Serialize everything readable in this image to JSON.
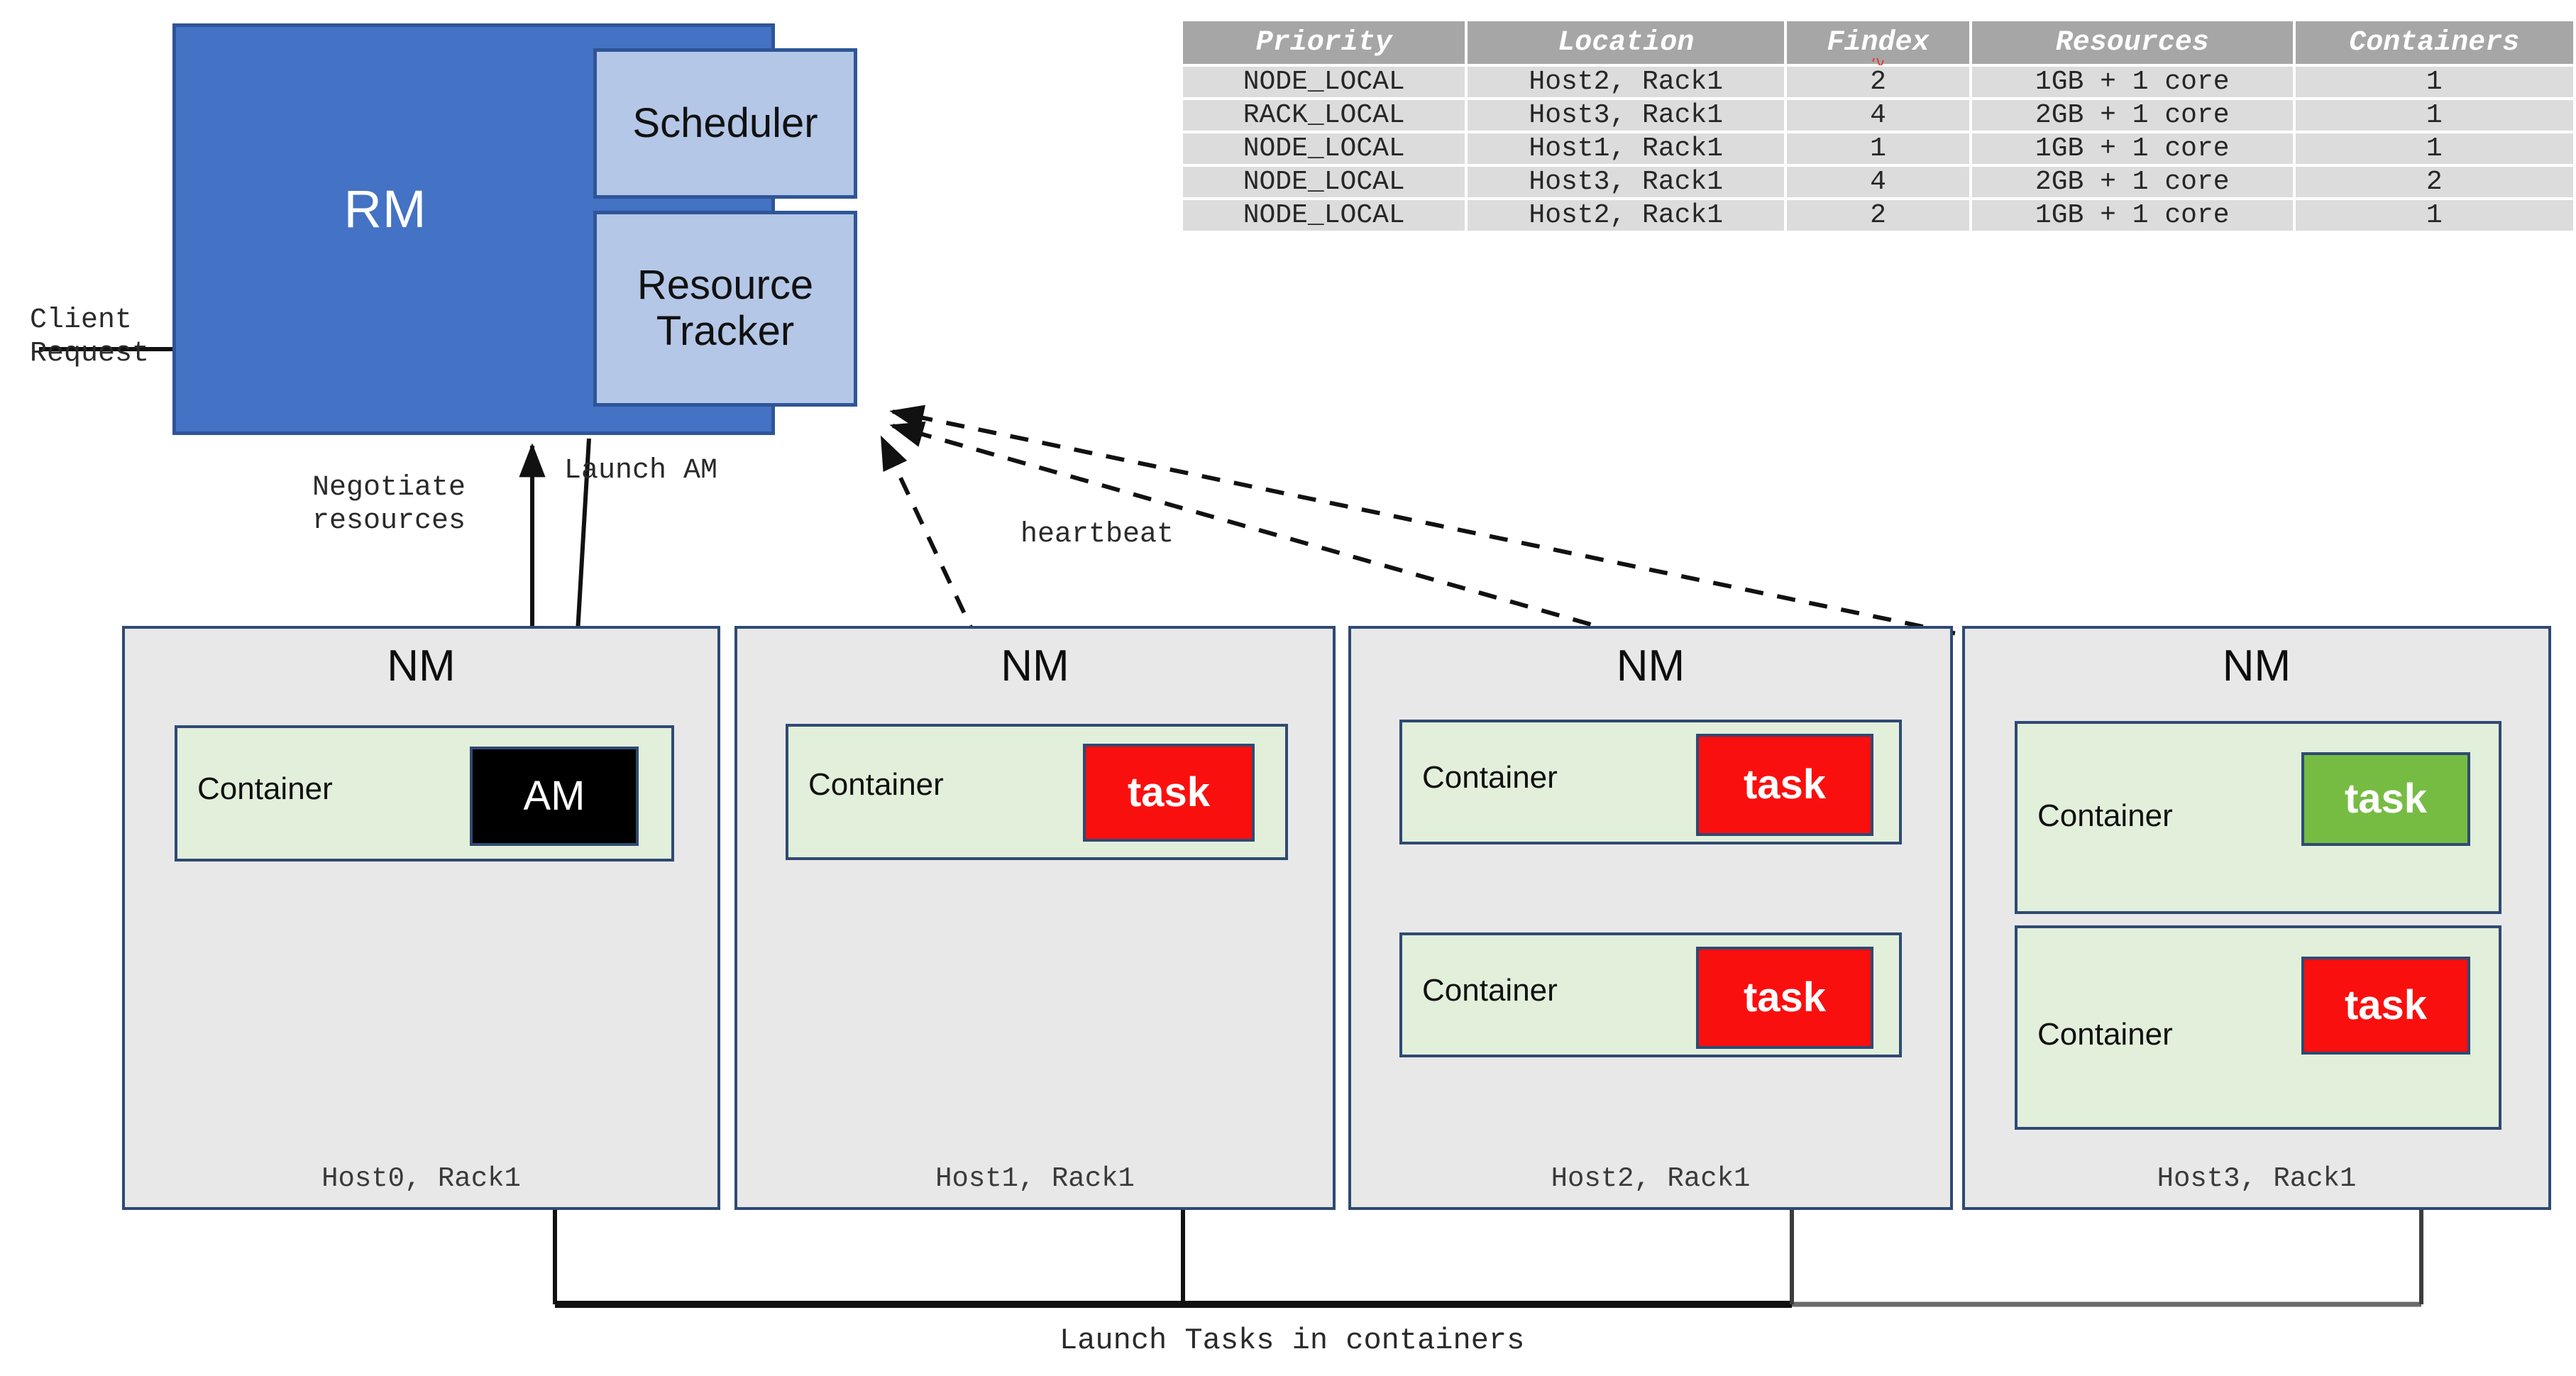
{
  "diagram": {
    "rm": {
      "label": "RM",
      "scheduler": "Scheduler",
      "resource_tracker": "Resource\nTracker",
      "fill_color": "#4472C4",
      "sub_fill_color": "#B4C7E7",
      "border_color": "#2F5597"
    },
    "annotations": {
      "client_request": "Client\nRequest",
      "negotiate_resources": "Negotiate\nresources",
      "launch_am": "Launch AM",
      "heartbeat": "heartbeat",
      "launch_tasks": "Launch Tasks in containers"
    },
    "nodes": [
      {
        "title": "NM",
        "host": "Host0, Rack1",
        "containers": [
          {
            "label": "Container",
            "chip": {
              "text": "AM",
              "kind": "am",
              "color": "#000000"
            }
          }
        ]
      },
      {
        "title": "NM",
        "host": "Host1, Rack1",
        "containers": [
          {
            "label": "Container",
            "chip": {
              "text": "task",
              "kind": "red",
              "color": "#FA0F0F"
            }
          }
        ]
      },
      {
        "title": "NM",
        "host": "Host2, Rack1",
        "containers": [
          {
            "label": "Container",
            "chip": {
              "text": "task",
              "kind": "red",
              "color": "#FA0F0F"
            }
          },
          {
            "label": "Container",
            "chip": {
              "text": "task",
              "kind": "red",
              "color": "#FA0F0F"
            }
          }
        ]
      },
      {
        "title": "NM",
        "host": "Host3, Rack1",
        "containers": [
          {
            "label": "Container",
            "chip": {
              "text": "task",
              "kind": "grn",
              "color": "#76BC43"
            }
          },
          {
            "label": "Container",
            "chip": {
              "text": "task",
              "kind": "red",
              "color": "#FA0F0F"
            }
          }
        ]
      }
    ],
    "colors": {
      "nm_fill": "#E8E8E8",
      "nm_border": "#2F4A73",
      "container_fill": "#E2EFDA",
      "task_red": "#FA0F0F",
      "task_green": "#76BC43",
      "am_black": "#000000"
    }
  },
  "table": {
    "headers": [
      "Priority",
      "Location",
      "Findex",
      "Resources",
      "Containers"
    ],
    "spellcheck_marker_on": "Findex",
    "rows": [
      [
        "NODE_LOCAL",
        "Host2, Rack1",
        "2",
        "1GB + 1 core",
        "1"
      ],
      [
        "RACK_LOCAL",
        "Host3, Rack1",
        "4",
        "2GB + 1 core",
        "1"
      ],
      [
        "NODE_LOCAL",
        "Host1, Rack1",
        "1",
        "1GB + 1 core",
        "1"
      ],
      [
        "NODE_LOCAL",
        "Host3, Rack1",
        "4",
        "2GB + 1 core",
        "2"
      ],
      [
        "NODE_LOCAL",
        "Host2, Rack1",
        "2",
        "1GB + 1 core",
        "1"
      ]
    ],
    "header_fill": "#A6A6A6",
    "cell_fill": "#DCDCDC"
  }
}
